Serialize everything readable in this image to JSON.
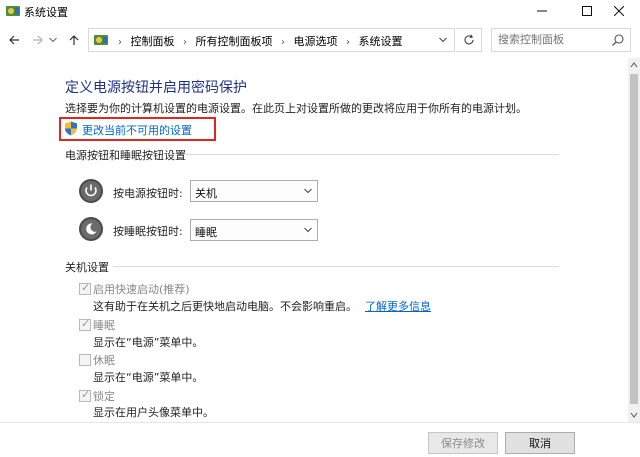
{
  "window": {
    "title": "系统设置"
  },
  "address": {
    "breadcrumbs": [
      "控制面板",
      "所有控制面板项",
      "电源选项",
      "系统设置"
    ],
    "search_placeholder": "搜索控制面板"
  },
  "page": {
    "title": "定义电源按钮并启用密码保护",
    "description": "选择要为你的计算机设置的电源设置。在此页上对设置所做的更改将应用于你所有的电源计划。",
    "change_link": "更改当前不可用的设置"
  },
  "buttons_section": {
    "heading": "电源按钮和睡眠按钮设置",
    "power_button_label": "按电源按钮时:",
    "power_button_value": "关机",
    "sleep_button_label": "按睡眠按钮时:",
    "sleep_button_value": "睡眠"
  },
  "shutdown_section": {
    "heading": "关机设置",
    "items": [
      {
        "label": "启用快速启动(推荐)",
        "checked": true,
        "desc": "这有助于在关机之后更快地启动电脑。不会影响重启。",
        "link": "了解更多信息"
      },
      {
        "label": "睡眠",
        "checked": true,
        "desc": "显示在“电源”菜单中。"
      },
      {
        "label": "休眠",
        "checked": false,
        "desc": "显示在“电源”菜单中。"
      },
      {
        "label": "锁定",
        "checked": true,
        "desc": "显示在用户头像菜单中。"
      }
    ]
  },
  "footer": {
    "save_label": "保存修改",
    "cancel_label": "取消"
  },
  "colors": {
    "title_blue": "#1e3287",
    "link_blue": "#0066cc",
    "highlight_red": "#e0271f"
  }
}
